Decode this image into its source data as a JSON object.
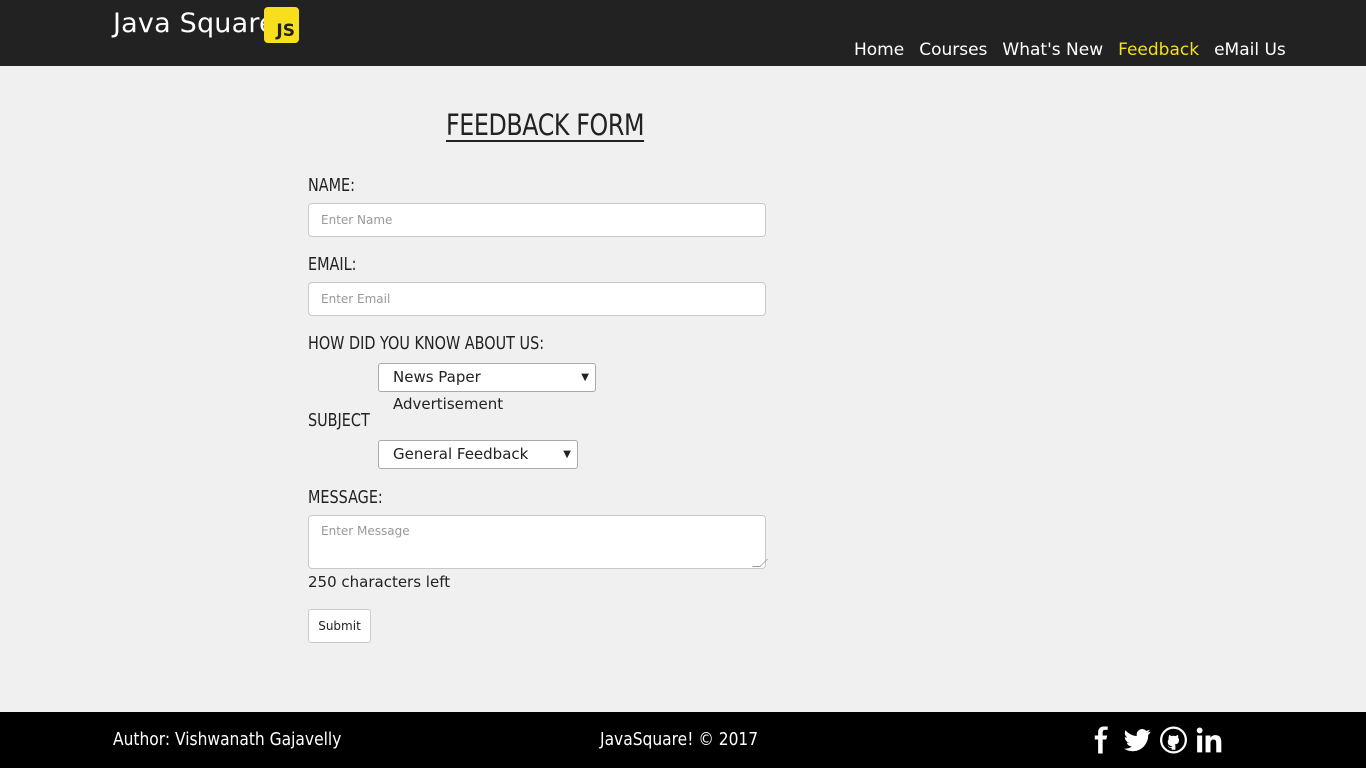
{
  "header": {
    "brand": "Java Square",
    "logo_text": "JS",
    "nav": [
      {
        "label": "Home",
        "active": false
      },
      {
        "label": "Courses",
        "active": false
      },
      {
        "label": "What's New",
        "active": false
      },
      {
        "label": "Feedback",
        "active": true
      },
      {
        "label": "eMail Us",
        "active": false
      }
    ]
  },
  "form": {
    "title": "FEEDBACK FORM",
    "name_label": "NAME:",
    "name_placeholder": "Enter Name",
    "email_label": "EMAIL:",
    "email_placeholder": "Enter Email",
    "source_label": "HOW DID YOU KNOW ABOUT US:",
    "source_value": "News Paper Advertisement",
    "subject_label": "SUBJECT",
    "subject_value": "General Feedback",
    "message_label": "MESSAGE:",
    "message_placeholder": "Enter Message",
    "char_count": "250 characters left",
    "submit_label": "Submit"
  },
  "footer": {
    "author": "Author: Vishwanath Gajavelly",
    "copyright": "JavaSquare! © 2017",
    "social_icons": [
      "facebook-icon",
      "twitter-icon",
      "github-icon",
      "linkedin-icon"
    ]
  },
  "colors": {
    "header_bg": "#222222",
    "accent": "#f7df1e",
    "page_bg": "#f0f0f0",
    "footer_bg": "#000000"
  }
}
